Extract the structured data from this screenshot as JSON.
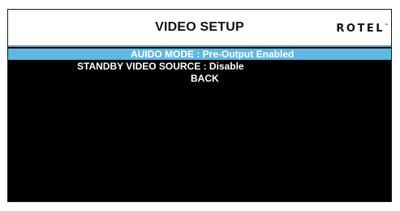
{
  "header": {
    "title": "VIDEO SETUP",
    "logo": "ROTEL",
    "logo_mark": "™"
  },
  "menu": {
    "items": [
      {
        "label": "AUIDO MODE",
        "separator": " : ",
        "value": "Pre-Output Enabled",
        "selected": true
      },
      {
        "label": "STANDBY VIDEO SOURCE",
        "separator": " : ",
        "value": "Disable",
        "selected": false
      },
      {
        "label": "BACK",
        "selected": false
      }
    ]
  },
  "colors": {
    "selection_highlight": "#5fb8e2",
    "screen_background": "#000000",
    "header_background": "#ffffff",
    "menu_text": "#ffffff"
  }
}
